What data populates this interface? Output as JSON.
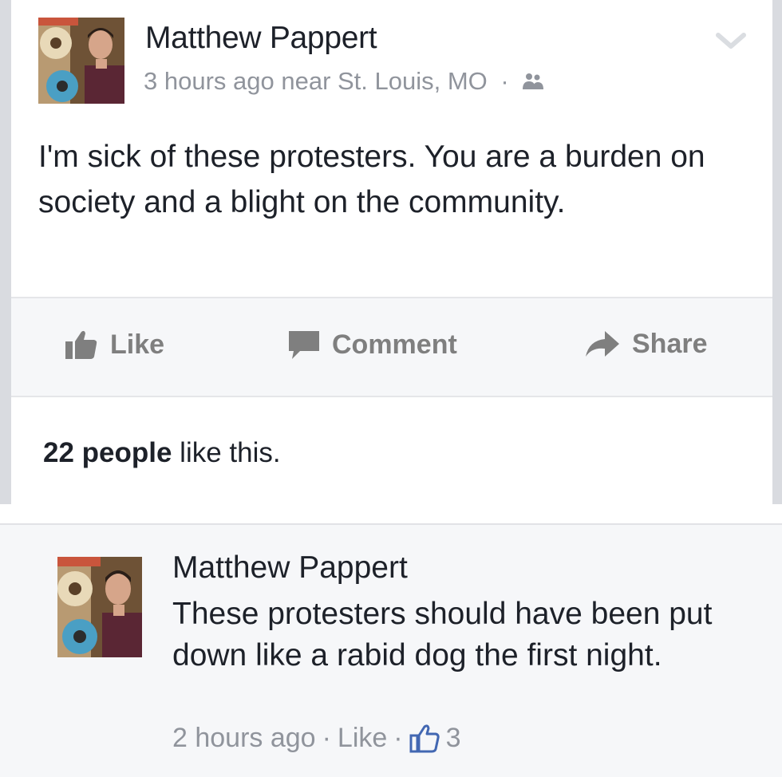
{
  "post": {
    "author": "Matthew Pappert",
    "time": "3 hours ago near St. Louis, MO",
    "separator": "·",
    "privacy_icon": "friends-icon",
    "text": "I'm sick of these protesters. You are a burden on society and a blight on the community.",
    "actions": {
      "like": "Like",
      "comment": "Comment",
      "share": "Share"
    },
    "likes_count": "22 people",
    "likes_suffix": " like this."
  },
  "comment": {
    "author": "Matthew Pappert",
    "text": "These protesters should have been put down like a rabid dog the first night.",
    "time": "2 hours ago",
    "separator": "·",
    "like_label": "Like",
    "separator2": "·",
    "like_count": "3"
  },
  "colors": {
    "text": "#1d2129",
    "muted": "#90949c",
    "action": "#7f7f7f",
    "bar_bg": "#f6f7f9"
  }
}
